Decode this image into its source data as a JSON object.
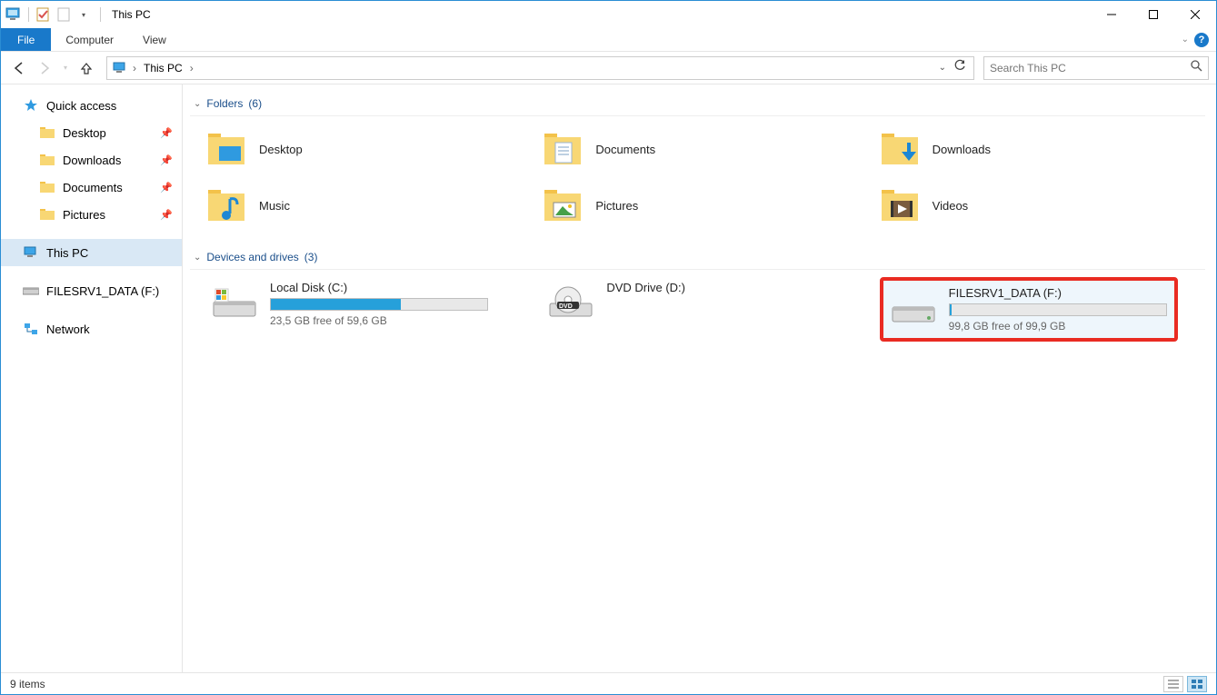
{
  "window": {
    "title": "This PC"
  },
  "ribbon": {
    "file": "File",
    "tabs": [
      "Computer",
      "View"
    ]
  },
  "nav": {
    "breadcrumb_root": "This PC",
    "search_placeholder": "Search This PC"
  },
  "sidebar": {
    "quick_access": "Quick access",
    "items": [
      {
        "label": "Desktop",
        "pinned": true
      },
      {
        "label": "Downloads",
        "pinned": true
      },
      {
        "label": "Documents",
        "pinned": true
      },
      {
        "label": "Pictures",
        "pinned": true
      }
    ],
    "this_pc": "This PC",
    "mapped_drive": "FILESRV1_DATA (F:)",
    "network": "Network"
  },
  "sections": {
    "folders": {
      "title": "Folders",
      "count": "(6)",
      "items": [
        "Desktop",
        "Documents",
        "Downloads",
        "Music",
        "Pictures",
        "Videos"
      ]
    },
    "drives": {
      "title": "Devices and drives",
      "count": "(3)"
    }
  },
  "drives": [
    {
      "title": "Local Disk (C:)",
      "status": "23,5 GB free of 59,6 GB",
      "fill_pct": 60
    },
    {
      "title": "DVD Drive (D:)",
      "status": "",
      "fill_pct": null
    },
    {
      "title": "FILESRV1_DATA (F:)",
      "status": "99,8 GB free of 99,9 GB",
      "fill_pct": 1
    }
  ],
  "statusbar": {
    "text": "9 items"
  }
}
